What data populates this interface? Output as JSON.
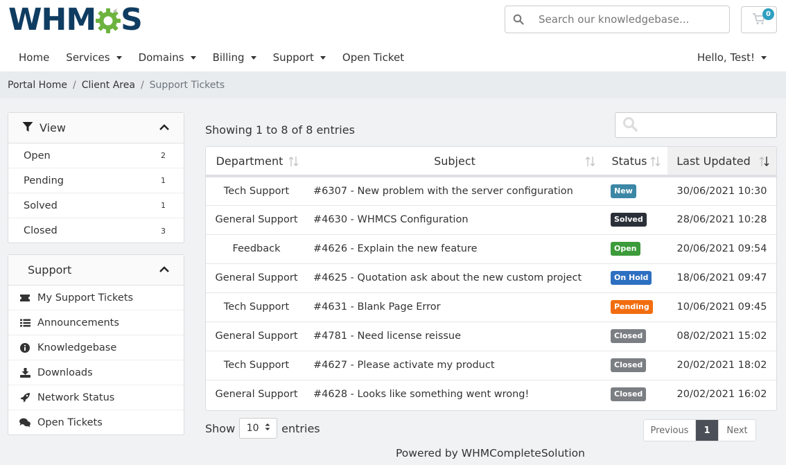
{
  "brand": {
    "logo_left": "WHM",
    "logo_right": "S",
    "colors": {
      "navy": "#0f3c61",
      "green": "#6db33f",
      "accent": "#2f9fc1"
    }
  },
  "header": {
    "search_placeholder": "Search our knowledgebase...",
    "cart_count": "0"
  },
  "nav": {
    "items": [
      {
        "label": "Home",
        "dropdown": false
      },
      {
        "label": "Services",
        "dropdown": true
      },
      {
        "label": "Domains",
        "dropdown": true
      },
      {
        "label": "Billing",
        "dropdown": true
      },
      {
        "label": "Support",
        "dropdown": true
      },
      {
        "label": "Open Ticket",
        "dropdown": false
      }
    ],
    "user": "Hello, Test!"
  },
  "breadcrumb": {
    "home": "Portal Home",
    "client": "Client Area",
    "current": "Support Tickets"
  },
  "sidebar": {
    "view": {
      "title": "View",
      "items": [
        {
          "label": "Open",
          "count": "2"
        },
        {
          "label": "Pending",
          "count": "1"
        },
        {
          "label": "Solved",
          "count": "1"
        },
        {
          "label": "Closed",
          "count": "3"
        }
      ]
    },
    "support": {
      "title": "Support",
      "items": [
        {
          "label": "My Support Tickets",
          "icon": "ticket-icon"
        },
        {
          "label": "Announcements",
          "icon": "list-icon"
        },
        {
          "label": "Knowledgebase",
          "icon": "info-circle-icon"
        },
        {
          "label": "Downloads",
          "icon": "download-icon"
        },
        {
          "label": "Network Status",
          "icon": "rocket-icon"
        },
        {
          "label": "Open Tickets",
          "icon": "comments-icon"
        }
      ]
    }
  },
  "main": {
    "showing": "Showing 1 to 8 of 8 entries",
    "columns": {
      "department": "Department",
      "subject": "Subject",
      "status": "Status",
      "updated": "Last Updated"
    },
    "rows": [
      {
        "department": "Tech Support",
        "subject": "#6307 - New problem with the server configuration",
        "status": "New",
        "status_color": "#3b87a5",
        "updated": "30/06/2021 10:30"
      },
      {
        "department": "General Support",
        "subject": "#4630 - WHMCS Configuration",
        "status": "Solved",
        "status_color": "#2b2f38",
        "updated": "28/06/2021 10:28"
      },
      {
        "department": "Feedback",
        "subject": "#4626 - Explain the new feature",
        "status": "Open",
        "status_color": "#3c9b3a",
        "updated": "20/06/2021 09:54"
      },
      {
        "department": "General Support",
        "subject": "#4625 - Quotation ask about the new custom project",
        "status": "On Hold",
        "status_color": "#2d6fc1",
        "updated": "18/06/2021 09:47"
      },
      {
        "department": "Tech Support",
        "subject": "#4631 - Blank Page Error",
        "status": "Pending",
        "status_color": "#f26d0f",
        "updated": "10/06/2021 09:45"
      },
      {
        "department": "General Support",
        "subject": "#4781 - Need license reissue",
        "status": "Closed",
        "status_color": "#7b7f83",
        "updated": "08/02/2021 15:02"
      },
      {
        "department": "Tech Support",
        "subject": "#4627 - Please activate my product",
        "status": "Closed",
        "status_color": "#7b7f83",
        "updated": "20/02/2021 18:02"
      },
      {
        "department": "General Support",
        "subject": "#4628 - Looks like something went wrong!",
        "status": "Closed",
        "status_color": "#7b7f83",
        "updated": "20/02/2021 16:02"
      }
    ],
    "show_label": "Show",
    "entries_value": "10",
    "entries_label": "entries",
    "pagination": {
      "previous": "Previous",
      "page": "1",
      "next": "Next"
    }
  },
  "footer": {
    "powered": "Powered by WHMCompleteSolution"
  }
}
